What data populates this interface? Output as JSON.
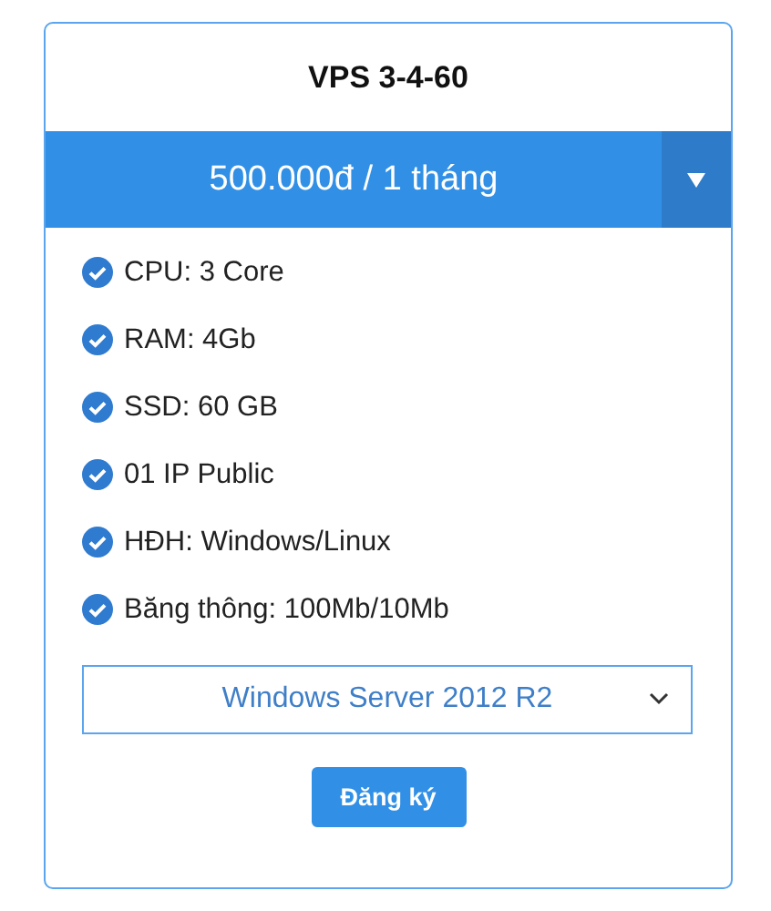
{
  "plan": {
    "title": "VPS 3-4-60",
    "price": "500.000đ / 1 tháng",
    "features": [
      "CPU: 3 Core",
      "RAM: 4Gb",
      "SSD: 60 GB",
      "01 IP Public",
      "HĐH: Windows/Linux",
      "Băng thông: 100Mb/10Mb"
    ],
    "os_select": {
      "value": "Windows Server 2012 R2"
    },
    "button": "Đăng ký"
  }
}
